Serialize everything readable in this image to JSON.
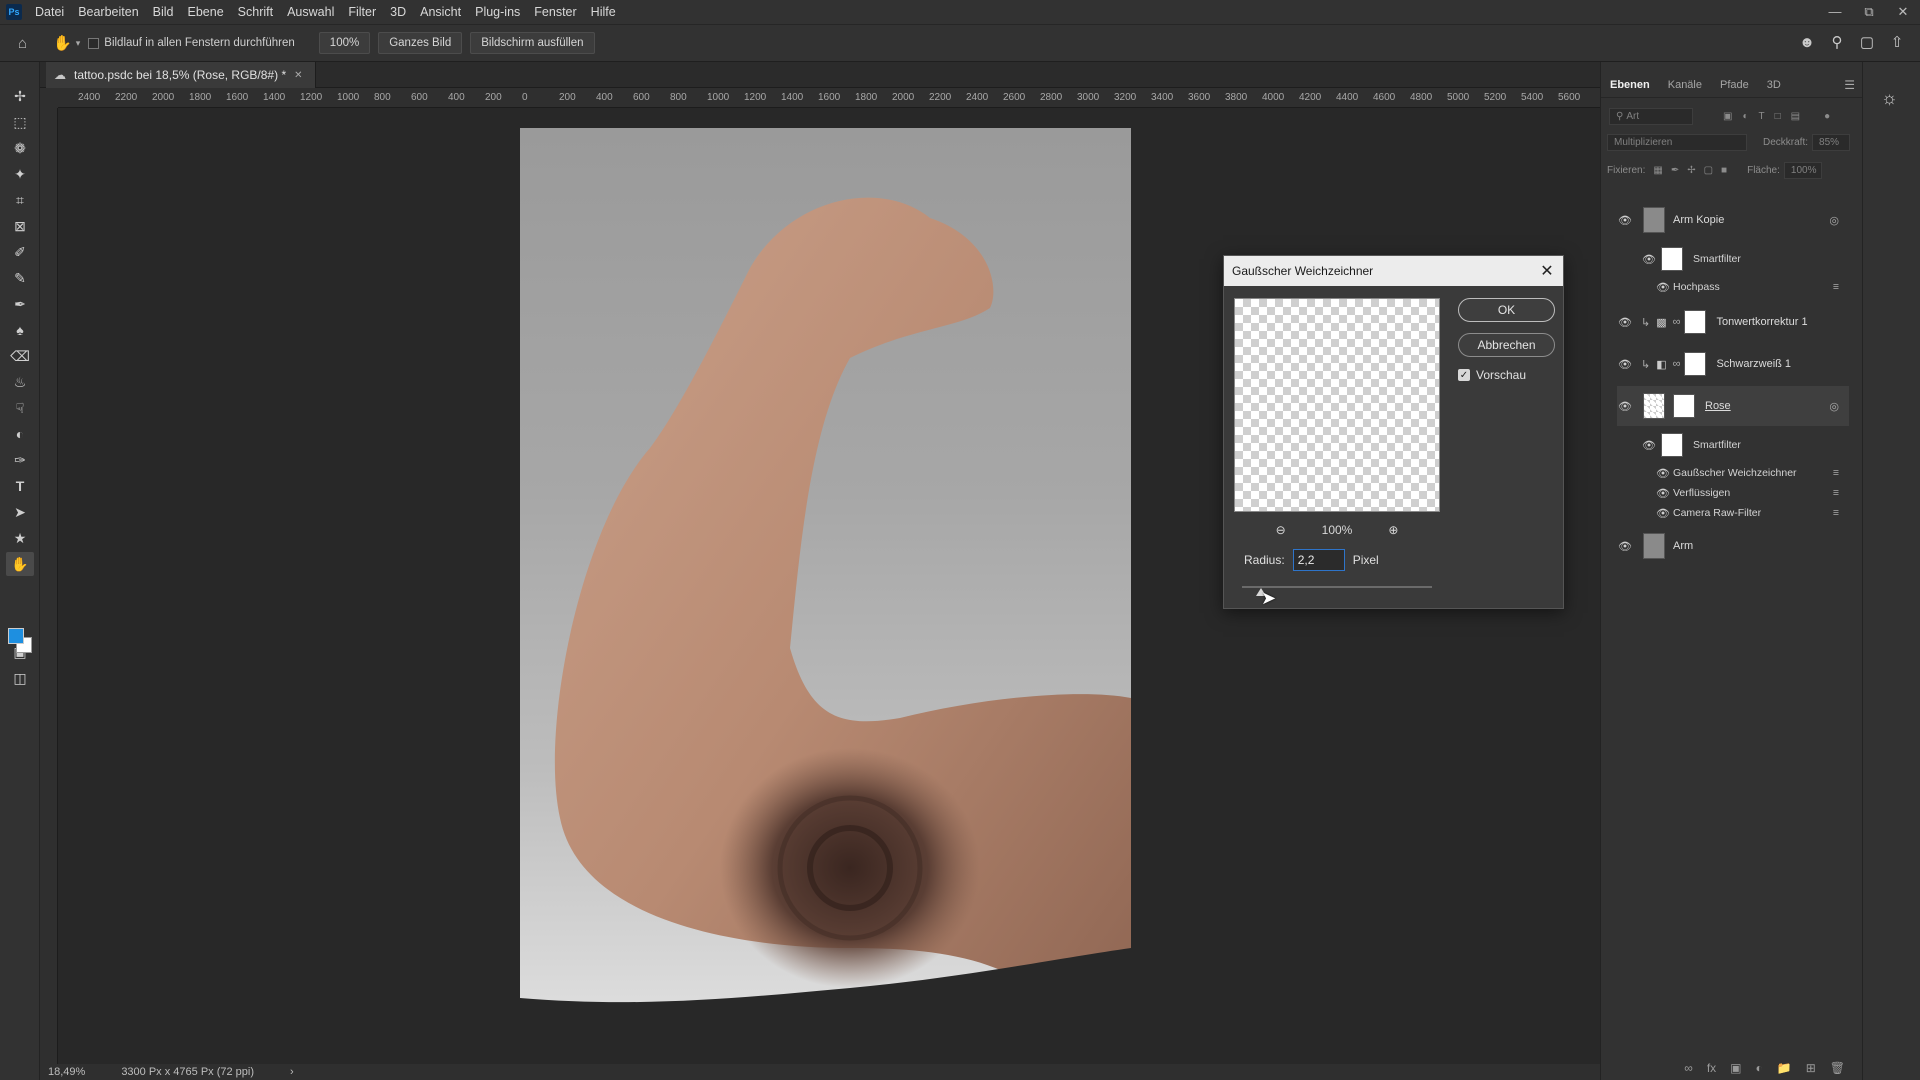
{
  "menubar": {
    "logo": "Ps",
    "items": [
      "Datei",
      "Bearbeiten",
      "Bild",
      "Ebene",
      "Schrift",
      "Auswahl",
      "Filter",
      "3D",
      "Ansicht",
      "Plug-ins",
      "Fenster",
      "Hilfe"
    ]
  },
  "options": {
    "scroll_all_label": "Bildlauf in allen Fenstern durchführen",
    "zoom_btn": "100%",
    "fit_btn": "Ganzes Bild",
    "fill_btn": "Bildschirm ausfüllen"
  },
  "document": {
    "tab_title": "tattoo.psdc bei 18,5% (Rose, RGB/8#) *",
    "ruler_ticks": [
      "2400",
      "2200",
      "2000",
      "1800",
      "1600",
      "1400",
      "1200",
      "1000",
      "800",
      "600",
      "400",
      "200",
      "0",
      "200",
      "400",
      "600",
      "800",
      "1000",
      "1200",
      "1400",
      "1600",
      "1800",
      "2000",
      "2200",
      "2400",
      "2600",
      "2800",
      "3000",
      "3200",
      "3400",
      "3600",
      "3800",
      "4000",
      "4200",
      "4400",
      "4600",
      "4800",
      "5000",
      "5200",
      "5400",
      "5600"
    ]
  },
  "status": {
    "zoom": "18,49%",
    "doc_size": "3300 Px x 4765 Px (72 ppi)"
  },
  "panel": {
    "tabs": [
      "Ebenen",
      "Kanäle",
      "Pfade",
      "3D"
    ],
    "search_placeholder": "Art",
    "blend_mode": "Multiplizieren",
    "opacity_label": "Deckkraft:",
    "opacity_value": "85%",
    "lock_label": "Fixieren:",
    "fill_label": "Fläche:",
    "fill_value": "100%",
    "layers": {
      "arm_kopie": "Arm Kopie",
      "smartfilter_1": "Smartfilter",
      "hochpass": "Hochpass",
      "tonwert": "Tonwertkorrektur 1",
      "schwarzweiss": "Schwarzweiß 1",
      "rose": "Rose",
      "smartfilter_2": "Smartfilter",
      "gauss": "Gaußscher Weichzeichner",
      "verfluessigen": "Verflüssigen",
      "camera_raw": "Camera Raw-Filter",
      "arm": "Arm"
    }
  },
  "dialog": {
    "title": "Gaußscher Weichzeichner",
    "ok": "OK",
    "cancel": "Abbrechen",
    "preview_label": "Vorschau",
    "preview_checked": true,
    "zoom": "100%",
    "radius_label": "Radius:",
    "radius_value": "2,2",
    "radius_unit": "Pixel"
  },
  "colors": {
    "foreground": "#1e8fe0",
    "background": "#ffffff",
    "accent": "#31a8ff"
  }
}
